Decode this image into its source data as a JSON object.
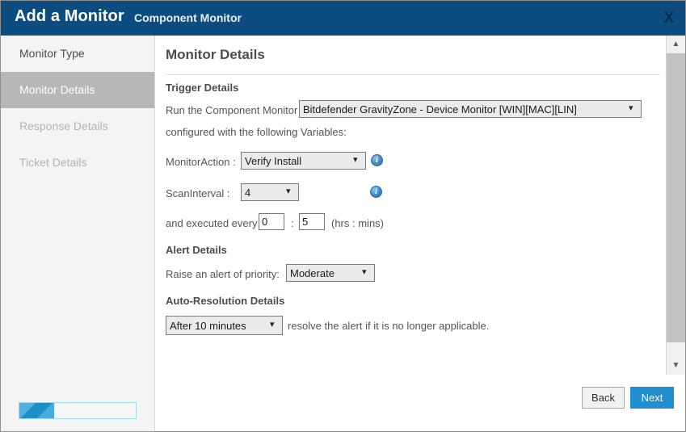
{
  "window": {
    "title": "Add a Monitor",
    "subtitle": "Component Monitor",
    "close_label": "X"
  },
  "sidebar": {
    "items": [
      {
        "label": "Monitor Type",
        "state": "visited"
      },
      {
        "label": "Monitor Details",
        "state": "active"
      },
      {
        "label": "Response Details",
        "state": "disabled"
      },
      {
        "label": "Ticket Details",
        "state": "disabled"
      }
    ],
    "progress_percent": 30
  },
  "main": {
    "page_title": "Monitor Details",
    "trigger": {
      "heading": "Trigger Details",
      "run_label": "Run the Component Monitor",
      "component_value": "Bitdefender GravityZone - Device Monitor [WIN][MAC][LIN]",
      "configured_label": "configured with the following Variables:",
      "monitor_action_label": "MonitorAction :",
      "monitor_action_value": "Verify Install",
      "scan_interval_label": "ScanInterval :",
      "scan_interval_value": "4",
      "executed_label": "and executed every",
      "hours_value": "0",
      "separator": ":",
      "minutes_value": "5",
      "units_label": "(hrs : mins)"
    },
    "alert": {
      "heading": "Alert Details",
      "priority_label": "Raise an alert of priority:",
      "priority_value": "Moderate"
    },
    "autores": {
      "heading": "Auto-Resolution Details",
      "delay_value": "After 10 minutes",
      "trailing_text": "resolve the alert if it is no longer applicable."
    }
  },
  "footer": {
    "back_label": "Back",
    "next_label": "Next"
  },
  "scrollbar": {
    "up_icon": "▲",
    "down_icon": "▼"
  },
  "icons": {
    "info": "i",
    "chevron_down": "⌄"
  },
  "colors": {
    "header_blue": "#0d4c7e",
    "accent_blue": "#1f8fd0",
    "sidebar_active": "#b7b7b7"
  }
}
